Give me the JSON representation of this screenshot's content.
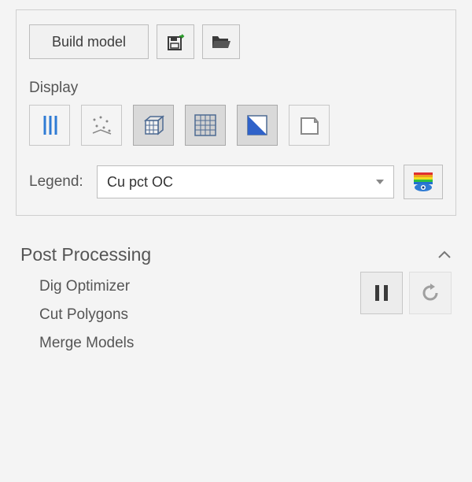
{
  "toolbar": {
    "build_label": "Build model"
  },
  "display": {
    "section_label": "Display",
    "legend_label": "Legend:",
    "legend_value": "Cu pct OC"
  },
  "post": {
    "title": "Post Processing",
    "items": [
      "Dig Optimizer",
      "Cut Polygons",
      "Merge Models"
    ]
  }
}
